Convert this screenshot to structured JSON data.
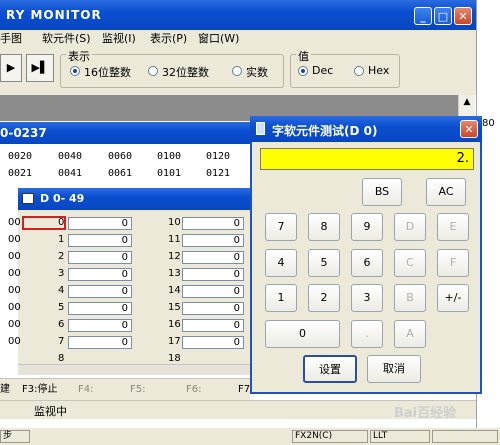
{
  "main": {
    "title": "RY MONITOR",
    "menu": [
      "软元件(S)",
      "监视(I)",
      "表示(P)",
      "窗口(W)"
    ],
    "display_group": "表示",
    "display_opts": [
      "16位整数",
      "32位整数",
      "实数"
    ],
    "value_group": "值",
    "value_opts": [
      "Dec",
      "Hex"
    ],
    "range_label": "0-0237",
    "grid_row1": [
      "0020",
      "0040",
      "0060",
      "0100",
      "0120"
    ],
    "grid_row2": [
      "0021",
      "0041",
      "0061",
      "0101",
      "0121"
    ],
    "fkeys": [
      "建",
      "F3:停止",
      "F4:",
      "F5:",
      "F6:",
      "F7"
    ],
    "monitoring": "监视中",
    "status_left": "步",
    "plc": "FX2N(C)",
    "llt": "LLT"
  },
  "dwin": {
    "title": "D  0- 49",
    "left_labels": [
      "0",
      "1",
      "2",
      "3",
      "4",
      "5",
      "6",
      "7",
      "8"
    ],
    "left_values": [
      "0",
      "0",
      "0",
      "0",
      "0",
      "0",
      "0",
      "0",
      ""
    ],
    "right_labels": [
      "10",
      "11",
      "12",
      "13",
      "14",
      "15",
      "16",
      "17",
      "18"
    ],
    "right_values": [
      "0",
      "0",
      "0",
      "0",
      "0",
      "0",
      "0",
      "0",
      ""
    ],
    "left_prefix": [
      "00",
      "00",
      "00",
      "00",
      "00",
      "00",
      "00",
      "00",
      ""
    ]
  },
  "calc": {
    "title": "字软元件测试(D 0)",
    "display": "2.",
    "keys": {
      "bs": "BS",
      "ac": "AC",
      "k7": "7",
      "k8": "8",
      "k9": "9",
      "kD": "D",
      "kE": "E",
      "k4": "4",
      "k5": "5",
      "k6": "6",
      "kC": "C",
      "kF": "F",
      "k1": "1",
      "k2": "2",
      "k3": "3",
      "kB": "B",
      "sign": "+/-",
      "k0": "0",
      "dot": ".",
      "kA": "A"
    },
    "set": "设置",
    "cancel": "取消"
  },
  "right_edge_text": "80",
  "watermark": "Bai百经验"
}
